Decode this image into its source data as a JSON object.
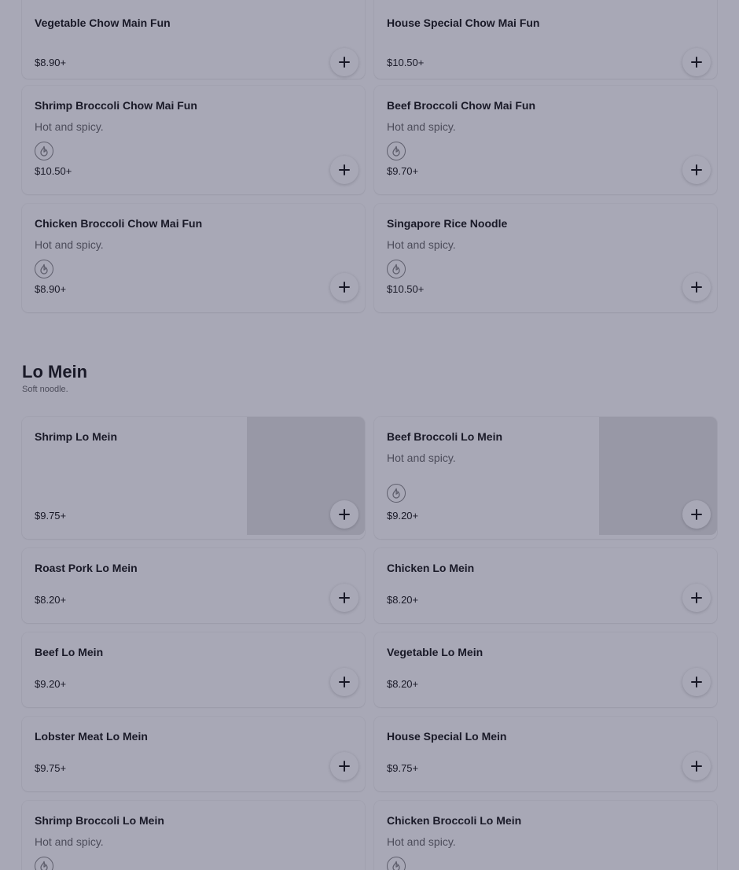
{
  "top_items": [
    {
      "name": "Vegetable Chow Main Fun",
      "desc": "",
      "spicy": false,
      "price": "$8.90+"
    },
    {
      "name": "House Special Chow Mai Fun",
      "desc": "",
      "spicy": false,
      "price": "$10.50+"
    },
    {
      "name": "Shrimp Broccoli Chow Mai Fun",
      "desc": "Hot and spicy.",
      "spicy": true,
      "price": "$10.50+"
    },
    {
      "name": "Beef Broccoli Chow Mai Fun",
      "desc": "Hot and spicy.",
      "spicy": true,
      "price": "$9.70+"
    },
    {
      "name": "Chicken Broccoli Chow Mai Fun",
      "desc": "Hot and spicy.",
      "spicy": true,
      "price": "$8.90+"
    },
    {
      "name": "Singapore Rice Noodle",
      "desc": "Hot and spicy.",
      "spicy": true,
      "price": "$10.50+"
    }
  ],
  "section": {
    "title": "Lo Mein",
    "subtitle": "Soft noodle."
  },
  "lo_mein_items": [
    {
      "name": "Shrimp Lo Mein",
      "desc": "",
      "spicy": false,
      "price": "$9.75+"
    },
    {
      "name": "Beef Broccoli Lo Mein",
      "desc": "Hot and spicy.",
      "spicy": true,
      "price": "$9.20+"
    },
    {
      "name": "Roast Pork Lo Mein",
      "desc": "",
      "spicy": false,
      "price": "$8.20+"
    },
    {
      "name": "Chicken Lo Mein",
      "desc": "",
      "spicy": false,
      "price": "$8.20+"
    },
    {
      "name": "Beef Lo Mein",
      "desc": "",
      "spicy": false,
      "price": "$9.20+"
    },
    {
      "name": "Vegetable Lo Mein",
      "desc": "",
      "spicy": false,
      "price": "$8.20+"
    },
    {
      "name": "Lobster Meat Lo Mein",
      "desc": "",
      "spicy": false,
      "price": "$9.75+"
    },
    {
      "name": "House Special Lo Mein",
      "desc": "",
      "spicy": false,
      "price": "$9.75+"
    },
    {
      "name": "Shrimp Broccoli Lo Mein",
      "desc": "Hot and spicy.",
      "spicy": true,
      "price": ""
    },
    {
      "name": "Chicken Broccoli Lo Mein",
      "desc": "Hot and spicy.",
      "spicy": true,
      "price": ""
    }
  ],
  "icons": {
    "add": "plus-icon",
    "spicy": "flame-icon"
  },
  "colors": {
    "overlay": "#1a1a40"
  }
}
